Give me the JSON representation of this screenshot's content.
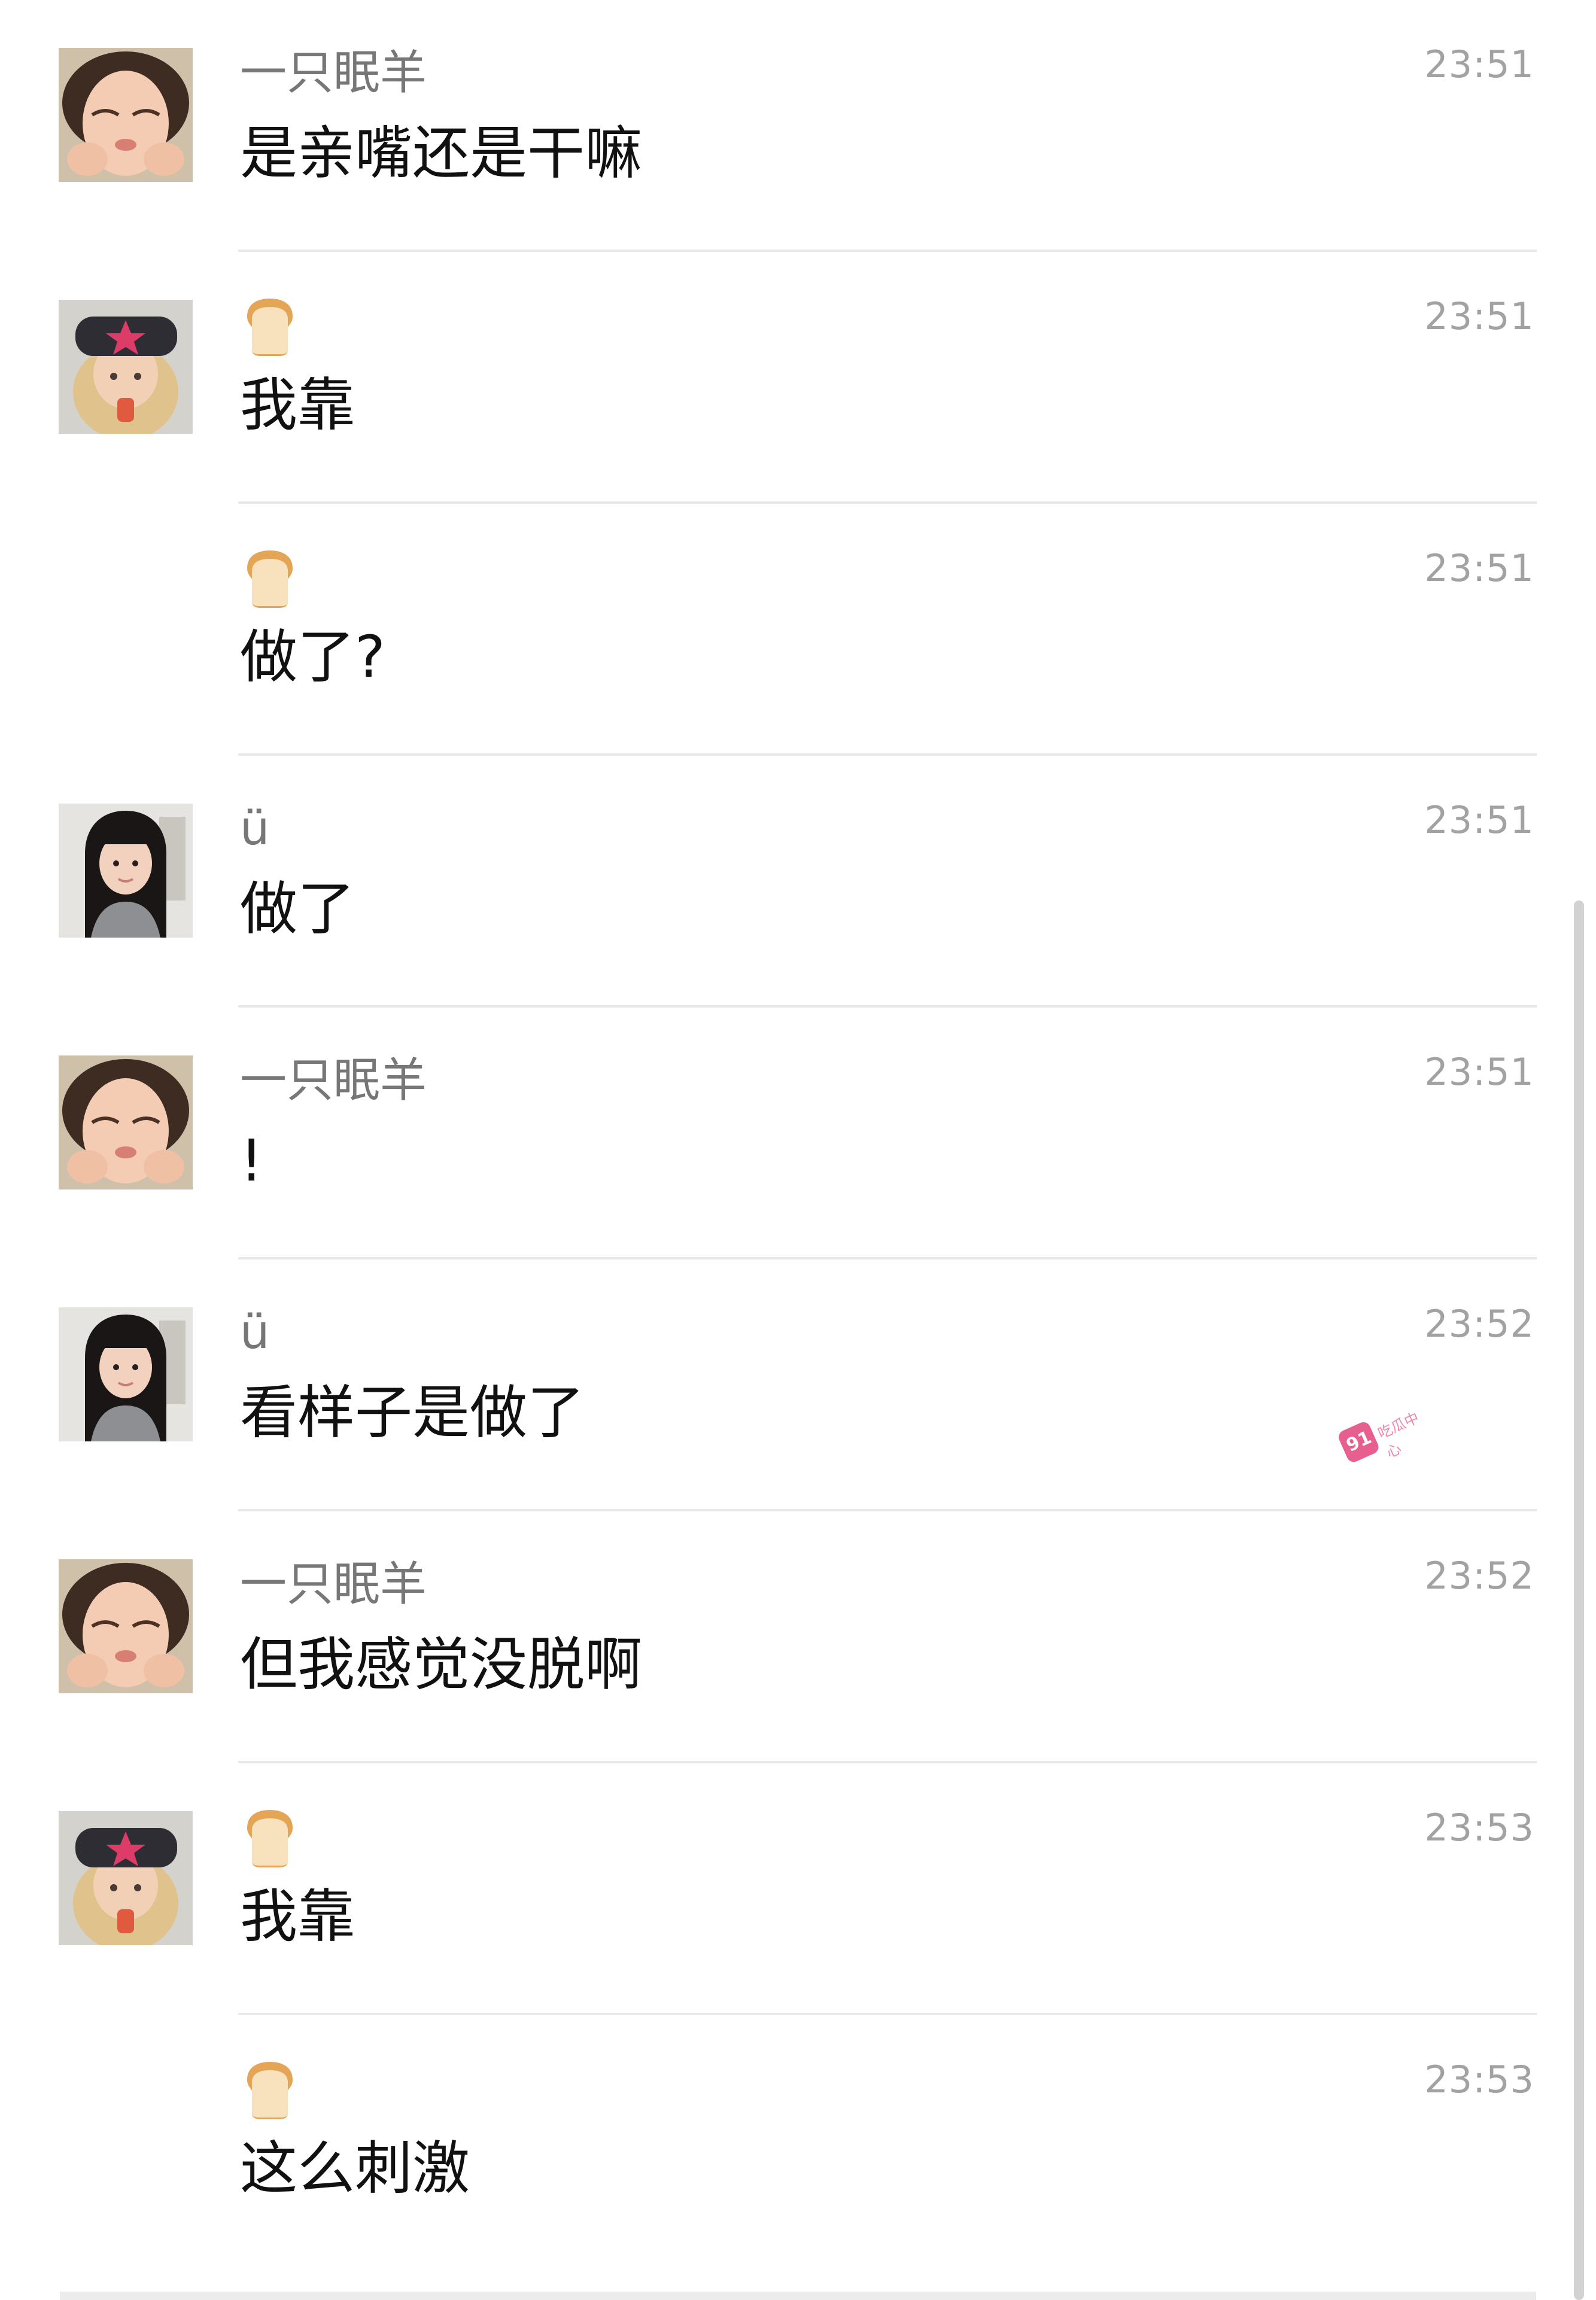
{
  "messages": [
    {
      "avatar": "crying-child-avatar",
      "sender": "一只眠羊",
      "sender_icon": null,
      "time": "23:51",
      "text": "是亲嘴还是干嘛"
    },
    {
      "avatar": "star-hat-girl-avatar",
      "sender": "",
      "sender_icon": "bread-icon",
      "time": "23:51",
      "text": "我靠"
    },
    {
      "avatar": null,
      "sender": "",
      "sender_icon": "bread-icon",
      "time": "23:51",
      "text": "做了?"
    },
    {
      "avatar": "long-hair-girl-avatar",
      "sender": "ü",
      "sender_icon": null,
      "time": "23:51",
      "text": "做了"
    },
    {
      "avatar": "crying-child-avatar",
      "sender": "一只眠羊",
      "sender_icon": null,
      "time": "23:51",
      "text": "!"
    },
    {
      "avatar": "long-hair-girl-avatar",
      "sender": "ü",
      "sender_icon": null,
      "time": "23:52",
      "text": "看样子是做了"
    },
    {
      "avatar": "crying-child-avatar",
      "sender": "一只眠羊",
      "sender_icon": null,
      "time": "23:52",
      "text": "但我感觉没脱啊"
    },
    {
      "avatar": "star-hat-girl-avatar",
      "sender": "",
      "sender_icon": "bread-icon",
      "time": "23:53",
      "text": "我靠"
    },
    {
      "avatar": null,
      "sender": "",
      "sender_icon": "bread-icon",
      "time": "23:53",
      "text": "这么刺激"
    }
  ],
  "watermark": {
    "badge": "91",
    "text": "吃瓜中心"
  },
  "colors": {
    "background": "#ffffff",
    "text": "#111111",
    "sender": "#777777",
    "timestamp": "#a2a2a2",
    "divider": "#e8e8e8",
    "watermark": "#e65f8f"
  }
}
